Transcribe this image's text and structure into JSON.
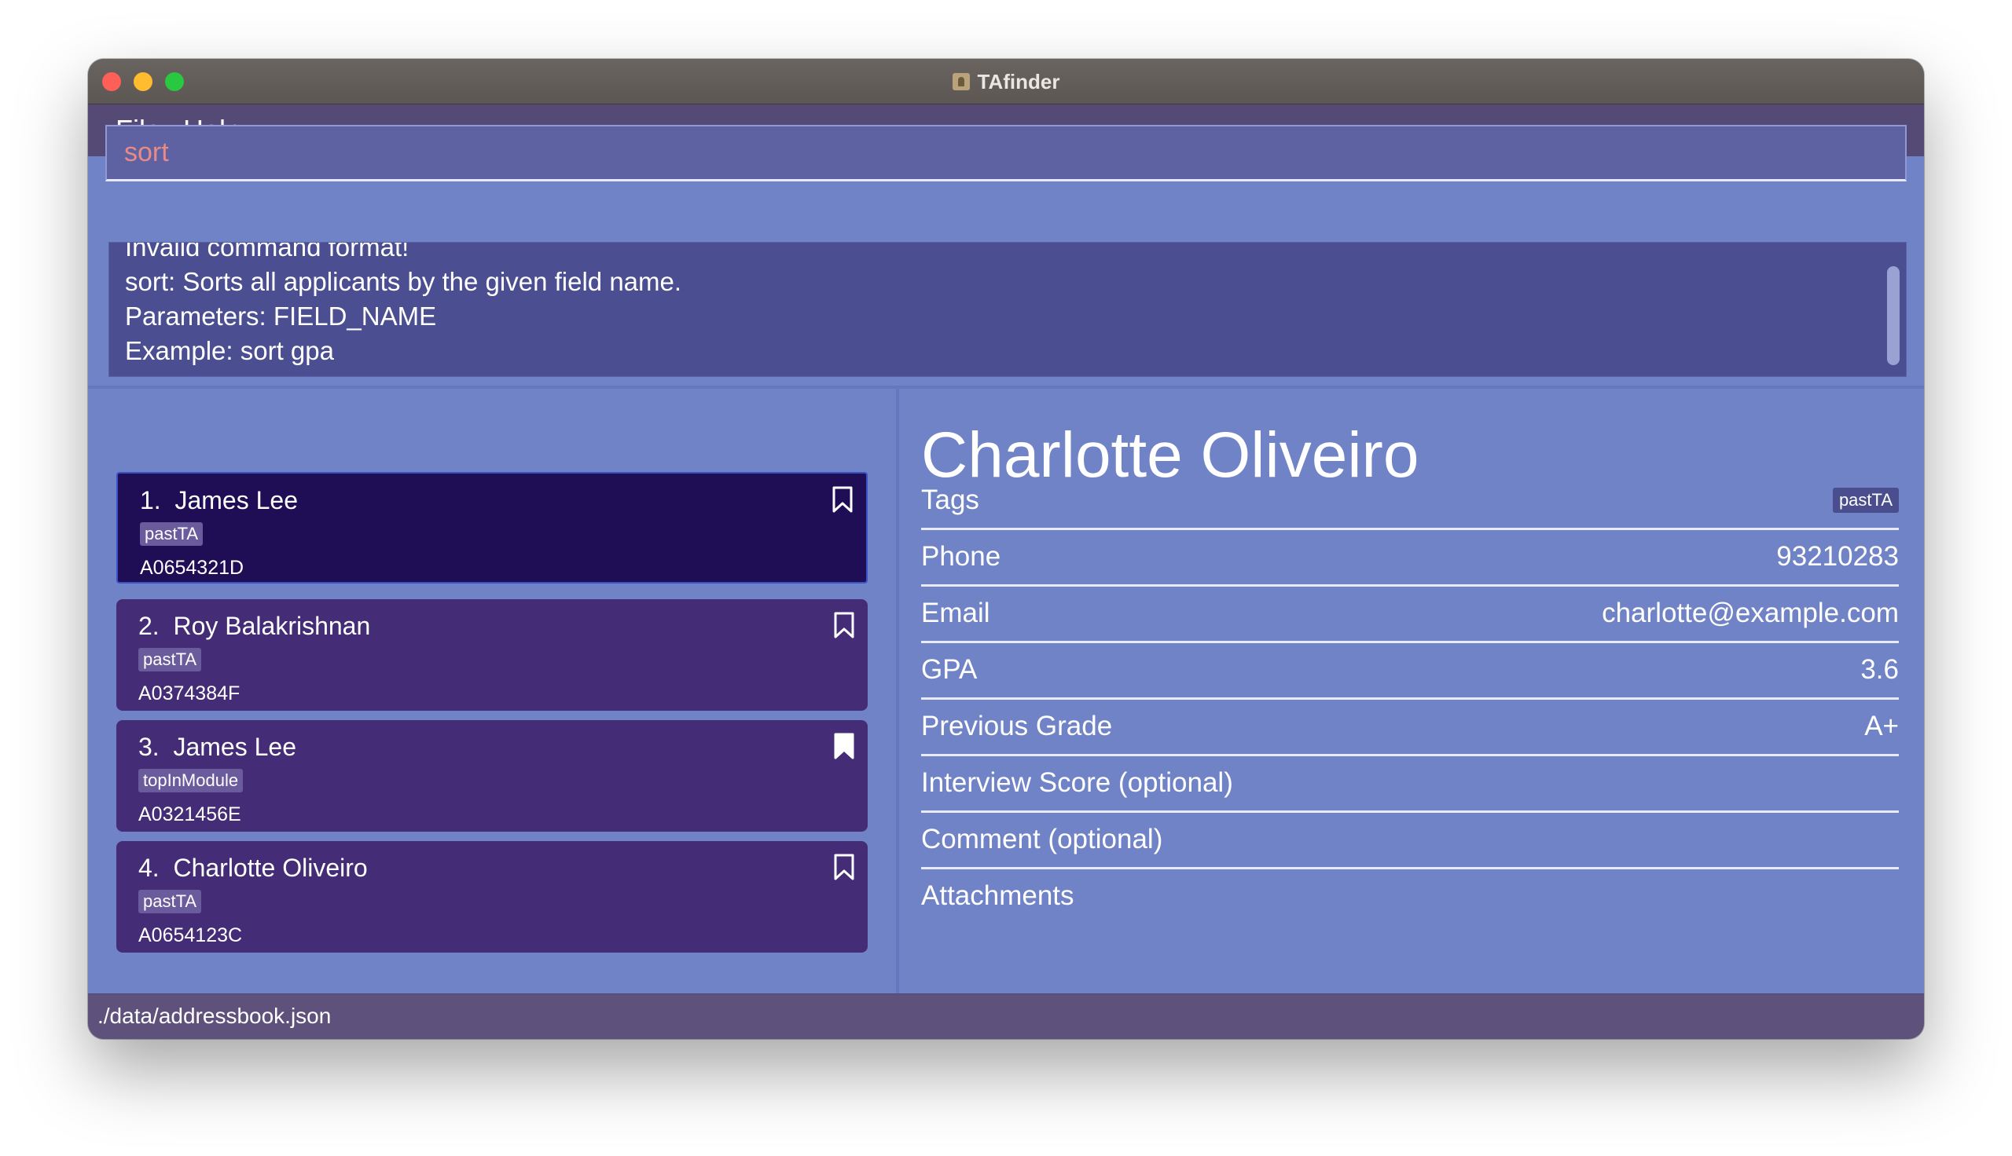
{
  "window": {
    "title": "TAfinder"
  },
  "menu": {
    "file": "File",
    "help": "Help"
  },
  "command": {
    "value": "sort"
  },
  "result": {
    "text": "Invalid command format!\nsort: Sorts all applicants by the given field name.\nParameters: FIELD_NAME\nExample: sort gpa"
  },
  "applicants": [
    {
      "index": "1.",
      "name": "James Lee",
      "tag": "pastTA",
      "id": "A0654321D",
      "bookmarked": false,
      "selected": true
    },
    {
      "index": "2.",
      "name": "Roy Balakrishnan",
      "tag": "pastTA",
      "id": "A0374384F",
      "bookmarked": false,
      "selected": false
    },
    {
      "index": "3.",
      "name": "James Lee",
      "tag": "topInModule",
      "id": "A0321456E",
      "bookmarked": true,
      "selected": false
    },
    {
      "index": "4.",
      "name": "Charlotte Oliveiro",
      "tag": "pastTA",
      "id": "A0654123C",
      "bookmarked": false,
      "selected": false
    }
  ],
  "detail": {
    "name": "Charlotte Oliveiro",
    "tags_label": "Tags",
    "tag": "pastTA",
    "phone_label": "Phone",
    "phone": "93210283",
    "email_label": "Email",
    "email": "charlotte@example.com",
    "gpa_label": "GPA",
    "gpa": "3.6",
    "grade_label": "Previous Grade",
    "grade": "A+",
    "interview_label": "Interview Score (optional)",
    "comment_label": "Comment (optional)",
    "attachments_label": "Attachments"
  },
  "status": {
    "path": "./data/addressbook.json"
  },
  "colors": {
    "background": "#7083c6",
    "card": "#442d76",
    "card_selected": "#1f0e55",
    "result_box": "#4b4e90",
    "command_text": "#e88a86"
  },
  "icons": {
    "bookmark": "bookmark-icon",
    "bookmark_filled": "bookmark-filled-icon"
  }
}
